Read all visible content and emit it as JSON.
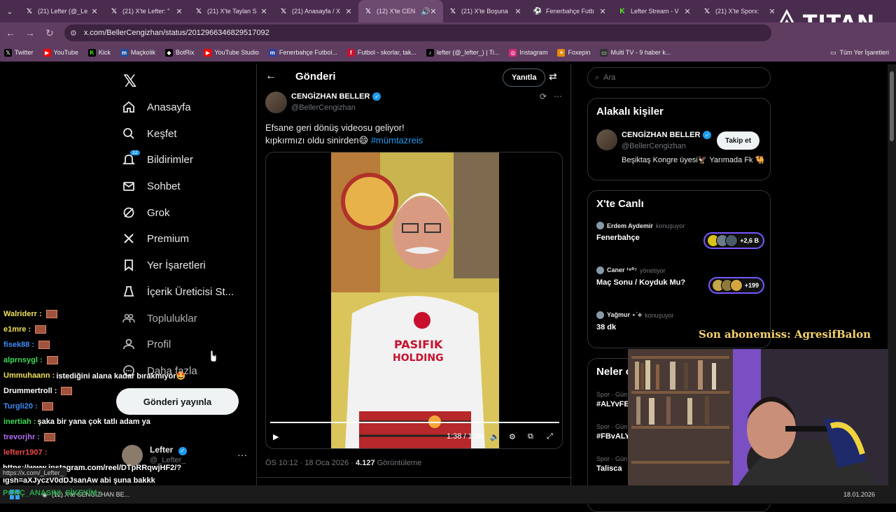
{
  "browser": {
    "tabs": [
      {
        "label": "(21) Lefter (@_Le",
        "icon": "x-logo-icon",
        "active": false
      },
      {
        "label": "(21) X'te Lefter: \"",
        "icon": "x-logo-icon",
        "active": false
      },
      {
        "label": "(21) X'te Taylan S",
        "icon": "x-logo-icon",
        "active": false
      },
      {
        "label": "(21) Anasayfa / X",
        "icon": "x-logo-icon",
        "active": false
      },
      {
        "label": "(12) X'te CEN",
        "icon": "x-logo-icon",
        "active": true
      },
      {
        "label": "(21) X'te Boşuna",
        "icon": "x-logo-icon",
        "active": false
      },
      {
        "label": "Fenerbahçe Futb",
        "icon": "fb-icon",
        "active": false
      },
      {
        "label": "Lefter Stream - V",
        "icon": "kick-icon",
        "active": false
      },
      {
        "label": "(21) X'te Sporx:",
        "icon": "x-logo-icon",
        "active": false
      }
    ],
    "url": "x.com/BellerCengizhan/status/2012966346829517092",
    "bookmarks": [
      {
        "label": "Twitter",
        "icon": "x-logo-icon"
      },
      {
        "label": "YouTube",
        "icon": "youtube-icon"
      },
      {
        "label": "Kick",
        "icon": "kick-icon"
      },
      {
        "label": "Maçkolik",
        "icon": "mackolik-icon"
      },
      {
        "label": "BotRix",
        "icon": "botrix-icon"
      },
      {
        "label": "YouTube Studio",
        "icon": "youtube-icon"
      },
      {
        "label": "Fenerbahçe Futbol...",
        "icon": "fb-icon"
      },
      {
        "label": "Futbol - skorlar, tak...",
        "icon": "flashscore-icon"
      },
      {
        "label": "lefter (@_lefter_) | Ti...",
        "icon": "tiktok-icon"
      },
      {
        "label": "Instagram",
        "icon": "instagram-icon"
      },
      {
        "label": "Foxepin",
        "icon": "foxepin-icon"
      },
      {
        "label": "Multi TV - 9 haber k...",
        "icon": "tv-icon"
      }
    ],
    "bookmarks_folder": "Tüm Yer İşaretleri",
    "overlay_logo": "TITAN"
  },
  "sidebar": {
    "items": [
      {
        "label": "Anasayfa",
        "icon": "home-icon"
      },
      {
        "label": "Keşfet",
        "icon": "search-icon"
      },
      {
        "label": "Bildirimler",
        "icon": "bell-icon",
        "badge": "12"
      },
      {
        "label": "Sohbet",
        "icon": "mail-icon"
      },
      {
        "label": "Grok",
        "icon": "grok-icon"
      },
      {
        "label": "Premium",
        "icon": "x-logo-icon"
      },
      {
        "label": "Yer İşaretleri",
        "icon": "bookmark-icon"
      },
      {
        "label": "İçerik Üreticisi St...",
        "icon": "creator-icon"
      },
      {
        "label": "Topluluklar",
        "icon": "people-icon"
      },
      {
        "label": "Profil",
        "icon": "person-icon"
      },
      {
        "label": "Daha fazla",
        "icon": "more-circle-icon"
      }
    ],
    "post_button": "Gönderi yayınla",
    "account": {
      "name": "Lefter",
      "handle": "@_Lefter_"
    }
  },
  "post": {
    "header_title": "Gönderi",
    "reply_button": "Yanıtla",
    "author_name": "CENGİZHAN BELLER",
    "author_handle": "@BellerCengizhan",
    "text_line1": "Efsane geri dönüş videosu geliyor!",
    "text_line2": "kıpkırmızı oldu sinirden😄 ",
    "hashtag": "#mümtazreis",
    "video_time": "1:38 / 1:38",
    "video_progress": 1.0,
    "meta_time": "ÖS 10:12 · 18 Oca 2026 · ",
    "meta_views": "4.127",
    "meta_views_label": " Görüntüleme"
  },
  "right": {
    "search_placeholder": "Ara",
    "related_title": "Alakalı kişiler",
    "related": {
      "name": "CENGİZHAN BELLER",
      "handle": "@BellerCengizhan",
      "bio": "Beşiktaş Kongre üyesi🦅 Yarımada Fk 🐫",
      "follow": "Takip et"
    },
    "live_title": "X'te Canlı",
    "live": [
      {
        "host": "Erdem Aydemir",
        "role": "konuşuyor",
        "title": "Fenerbahçe",
        "count": "+2,6 B"
      },
      {
        "host": "Caner ¹⁹⁰⁷",
        "role": "yönetiyor",
        "title": "Maç Sonu / Koyduk Mu?",
        "count": "+199"
      },
      {
        "host": "Yağmur ⋆˙⟡",
        "role": "konuşuyor",
        "title": "38 dk",
        "count": ""
      }
    ],
    "trends_title": "Neler o",
    "trends": [
      {
        "category": "Spor · Gün",
        "name": "#ALYvFE"
      },
      {
        "category": "Spor · Gün",
        "name": "#FBvALY"
      },
      {
        "category": "Spor · Gün",
        "name": "Talisca"
      }
    ]
  },
  "stream": {
    "chat": [
      {
        "user": "Walriderr",
        "msg": "",
        "color": "#f0e05a",
        "emote": true
      },
      {
        "user": "e1mre",
        "msg": "",
        "color": "#f0e05a",
        "emote": true
      },
      {
        "user": "fisek88",
        "msg": "",
        "color": "#3e8ef7",
        "emote": true
      },
      {
        "user": "alprnsygl",
        "msg": "",
        "color": "#3ddc5a",
        "emote": true
      },
      {
        "user": "Ummuhaann",
        "msg": "istediğini alana kadar bırakmıyor🤩",
        "color": "#f0e05a",
        "emote": false
      },
      {
        "user": "Drummertroll",
        "msg": "",
        "color": "#ffffff",
        "emote": true
      },
      {
        "user": "Turgli20",
        "msg": "",
        "color": "#3e8ef7",
        "emote": true
      },
      {
        "user": "inertiah",
        "msg": "şaka bir yana çok tatlı adam ya",
        "color": "#3ddc5a",
        "emote": false
      },
      {
        "user": "trevorjhr",
        "msg": "",
        "color": "#b06cf0",
        "emote": true
      },
      {
        "user": "lefterr1907",
        "msg": "",
        "color": "#f04a4a",
        "emote": false
      }
    ],
    "chat_link": "https://www.instagram.com/reel/DTpRRqwjHF2/?igsh=aXJyczV0dDJsanAw abi şuna bakkk",
    "status_url": "https://x.com/_Lefter_",
    "bottom_chat": "PONÇ_ANASINI_SİKEYİM :",
    "sub_alert": "Son abonemiss: AgresifBalon",
    "taskbar_app": "(12) X'te CENGİZHAN BE...",
    "taskbar_date": "18.01.2026"
  }
}
